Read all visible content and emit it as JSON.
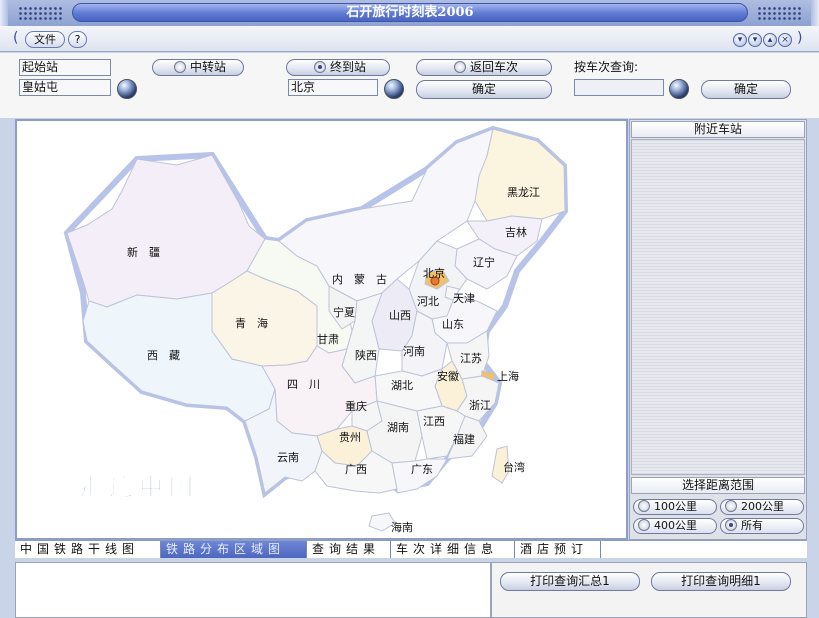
{
  "window": {
    "title": "石开旅行时刻表2006"
  },
  "menu": {
    "file_label": "文件",
    "help_label": "?"
  },
  "form": {
    "start_label": "起始站",
    "start_value": "皇姑屯",
    "transfer_label": "中转站",
    "end_label": "终到站",
    "end_value": "北京",
    "return_label": "返回车次",
    "confirm_label": "确定",
    "train_query_label": "按车次查询:",
    "train_query_value": "",
    "train_confirm_label": "确定"
  },
  "map": {
    "watermark": "走遍中国",
    "highlight_color": "#e07b39",
    "provinces": [
      {
        "id": "xinjiang",
        "name": "新　疆",
        "color": "#f4eef8"
      },
      {
        "id": "xizang",
        "name": "西　藏",
        "color": "#eef5fb"
      },
      {
        "id": "qinghai",
        "name": "青　海",
        "color": "#fbf5e8"
      },
      {
        "id": "neimenggu",
        "name": "内　蒙　古",
        "color": "#f7f7fb"
      },
      {
        "id": "heilongjiang",
        "name": "黑龙江",
        "color": "#fbf4df"
      },
      {
        "id": "jilin",
        "name": "吉林",
        "color": "#f3f0fa"
      },
      {
        "id": "liaoning",
        "name": "辽宁",
        "color": "#f6f4fb"
      },
      {
        "id": "beijing",
        "name": "北京",
        "color": "#f0c06d"
      },
      {
        "id": "hebei",
        "name": "河北",
        "color": "#f2f3f7"
      },
      {
        "id": "tianjin",
        "name": "天津",
        "color": "#f6f6f6"
      },
      {
        "id": "shanxi",
        "name": "山西",
        "color": "#ecebf6"
      },
      {
        "id": "ningxia",
        "name": "宁夏",
        "color": "#f3f3f3"
      },
      {
        "id": "gansu",
        "name": "甘肃",
        "color": "#f7f9f3"
      },
      {
        "id": "shaanxi",
        "name": "陕西",
        "color": "#f3f6f4"
      },
      {
        "id": "shandong",
        "name": "山东",
        "color": "#f7f7fb"
      },
      {
        "id": "henan",
        "name": "河南",
        "color": "#f4f4f8"
      },
      {
        "id": "jiangsu",
        "name": "江苏",
        "color": "#f5f5f5"
      },
      {
        "id": "anhui",
        "name": "安徽",
        "color": "#fbf1d8"
      },
      {
        "id": "shanghai",
        "name": "上海",
        "color": "#f0c06d"
      },
      {
        "id": "hubei",
        "name": "湖北",
        "color": "#f7f7f7"
      },
      {
        "id": "sichuan",
        "name": "四　川",
        "color": "#f8f1f5"
      },
      {
        "id": "chongqing",
        "name": "重庆",
        "color": "#f5f5f5"
      },
      {
        "id": "zhejiang",
        "name": "浙江",
        "color": "#f5f5f5"
      },
      {
        "id": "guizhou",
        "name": "贵州",
        "color": "#fbf1d8"
      },
      {
        "id": "hunan",
        "name": "湖南",
        "color": "#f4f4f4"
      },
      {
        "id": "jiangxi",
        "name": "江西",
        "color": "#f6f6f6"
      },
      {
        "id": "fujian",
        "name": "福建",
        "color": "#f4f4f4"
      },
      {
        "id": "yunnan",
        "name": "云南",
        "color": "#f1f5f9"
      },
      {
        "id": "guangxi",
        "name": "广西",
        "color": "#f7f7f7"
      },
      {
        "id": "guangdong",
        "name": "广东",
        "color": "#f7f7fb"
      },
      {
        "id": "taiwan",
        "name": "台湾",
        "color": "#fbf1d8"
      },
      {
        "id": "hainan",
        "name": "海南",
        "color": "#f7f7fb"
      }
    ]
  },
  "right_panel": {
    "nearby_title": "附近车站",
    "range_title": "选择距离范围",
    "ranges": [
      "100公里",
      "200公里",
      "400公里",
      "所有"
    ],
    "selected_range": "所有"
  },
  "tabs": [
    {
      "label": "中国铁路干线图",
      "active": false
    },
    {
      "label": "铁路分布区域图",
      "active": true
    },
    {
      "label": "查询结果",
      "active": false
    },
    {
      "label": "车次详细信息",
      "active": false
    },
    {
      "label": "酒店预订",
      "active": false
    }
  ],
  "bottom": {
    "print_summary_label": "打印查询汇总1",
    "print_detail_label": "打印查询明细1"
  }
}
